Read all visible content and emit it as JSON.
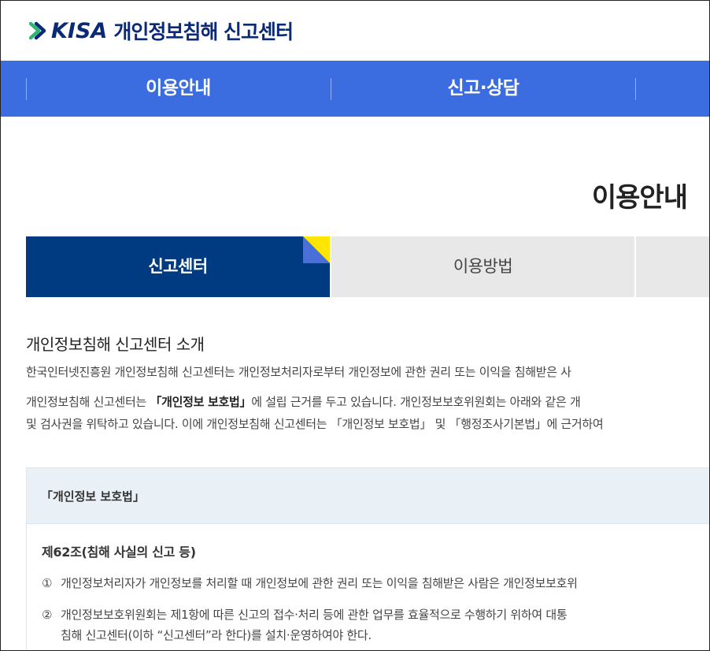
{
  "header": {
    "logo_text": "KISA",
    "site_name": "개인정보침해 신고센터"
  },
  "nav": {
    "items": [
      {
        "label": "이용안내"
      },
      {
        "label": "신고·상담"
      }
    ]
  },
  "page_title": "이용안내",
  "tabs": [
    {
      "label": "신고센터",
      "active": true
    },
    {
      "label": "이용방법",
      "active": false
    }
  ],
  "intro": {
    "title": "개인정보침해 신고센터 소개",
    "p1": "한국인터넷진흥원 개인정보침해 신고센터는 개인정보처리자로부터 개인정보에 관한 권리 또는 이익을 침해받은 사",
    "p2_pre": "개인정보침해 신고센터는 ",
    "p2_bold": "「개인정보 보호법」",
    "p2_post": "에 설립 근거를 두고 있습니다. 개인정보보호위원회는 아래와 같은 개",
    "p3": "및 검사권을 위탁하고 있습니다. 이에 개인정보침해 신고센터는 「개인정보 보호법」 및 「행정조사기본법」에 근거하여"
  },
  "law": {
    "header": "「개인정보 보호법」",
    "article_title": "제62조(침해 사실의 신고 등)",
    "clauses": [
      {
        "num": "①",
        "text": "개인정보처리자가 개인정보를 처리할 때 개인정보에 관한 권리 또는 이익을 침해받은 사람은 개인정보보호위"
      },
      {
        "num": "②",
        "text": "개인정보보호위원회는 제1항에 따른 신고의 접수·처리 등에 관한 업무를 효율적으로 수행하기 위하여 대통",
        "text2": "침해 신고센터(이하 “신고센터”라 한다)를 설치·운영하여야 한다."
      }
    ]
  },
  "colors": {
    "nav_bg": "#3c6de0",
    "tab_active_bg": "#003a80",
    "tab_inactive_bg": "#e8e8e8",
    "logo_blue": "#0a2a78",
    "logo_green": "#2bb673",
    "law_header_bg": "#e9f1f7"
  }
}
